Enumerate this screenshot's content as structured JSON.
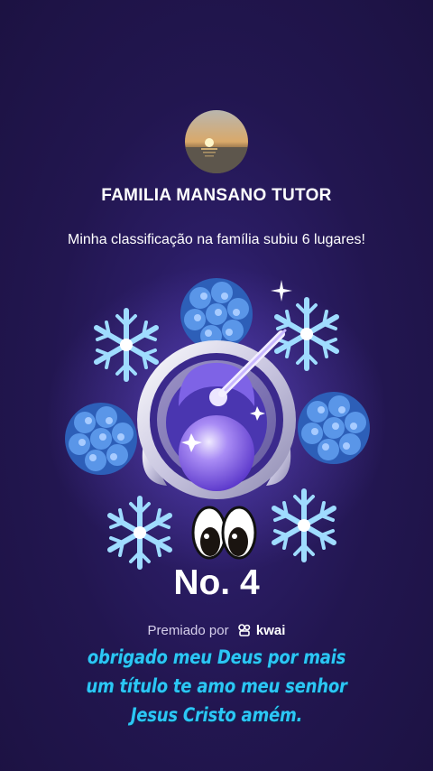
{
  "profile": {
    "name": "FAMILIA MANSANO TUTOR",
    "avatar_icon": "sunset-avatar"
  },
  "message": "Minha classificação na família subiu 6 lugares!",
  "badge": {
    "rank": "No. 4",
    "icons": [
      "snowflake-icon",
      "hydrangea-icon",
      "medal-emblem",
      "eyes-icon"
    ]
  },
  "footer": {
    "awarded_by": "Premiado por",
    "brand": "kwai"
  },
  "caption": {
    "lines": [
      "obrigado meu Deus por mais",
      "um título te amo meu senhor",
      "Jesus Cristo amém."
    ]
  },
  "colors": {
    "background": "#231751",
    "caption": "#2cc6f5",
    "snowflake": "#8fd8ff",
    "flower": "#3f7fd8"
  }
}
